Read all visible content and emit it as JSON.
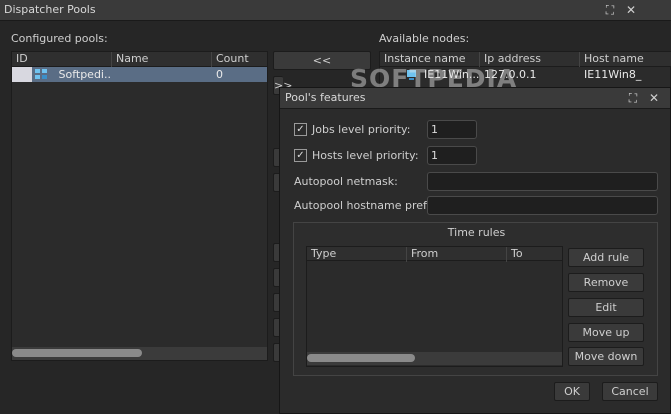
{
  "window": {
    "title": "Dispatcher Pools",
    "restore_glyph": "⛶",
    "close_glyph": "✕"
  },
  "watermark": "SOFTPEDIA",
  "configured_pools": {
    "label": "Configured pools:",
    "columns": [
      "ID",
      "Name",
      "Count"
    ],
    "rows": [
      {
        "id": "",
        "name": "Softpedi...",
        "count": "0",
        "icon": "pool-icon"
      }
    ]
  },
  "available_nodes": {
    "label": "Available nodes:",
    "columns": [
      "Instance name",
      "Ip address",
      "Host name"
    ],
    "rows": [
      {
        "instance": "IE11Win...",
        "ip": "127.0.0.1",
        "host": "IE11Win8_",
        "icon": "node-icon"
      }
    ]
  },
  "transfer": {
    "remove_label": "<<",
    "add_label": ">>"
  },
  "dialog": {
    "title": "Pool's features",
    "jobs_priority": {
      "label": "Jobs level priority:",
      "checked": true,
      "value": "1"
    },
    "hosts_priority": {
      "label": "Hosts level priority:",
      "checked": true,
      "value": "1"
    },
    "netmask": {
      "label": "Autopool netmask:",
      "value": ""
    },
    "hostname_prefix": {
      "label": "Autopool hostname prefix:",
      "value": ""
    },
    "time_rules": {
      "title": "Time rules",
      "columns": [
        "Type",
        "From",
        "To"
      ],
      "buttons": {
        "add": "Add rule",
        "remove": "Remove",
        "edit": "Edit",
        "move_up": "Move up",
        "move_down": "Move down"
      }
    },
    "ok_label": "OK",
    "cancel_label": "Cancel"
  }
}
